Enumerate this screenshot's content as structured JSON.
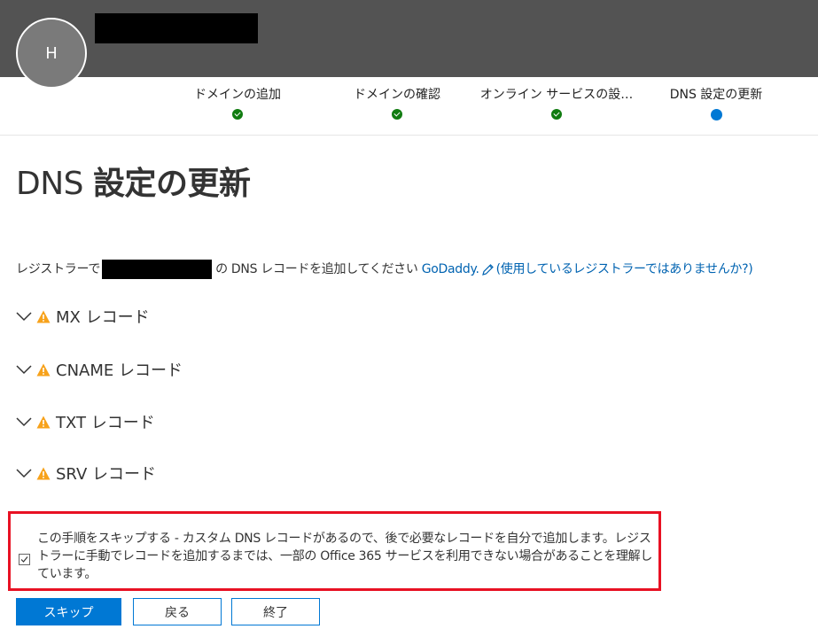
{
  "header": {
    "avatar_initial": "H"
  },
  "steps": [
    {
      "label": "ドメインの追加",
      "status": "done"
    },
    {
      "label": "ドメインの確認",
      "status": "done"
    },
    {
      "label": "オンライン サービスの設…",
      "status": "done"
    },
    {
      "label": "DNS 設定の更新",
      "status": "current"
    }
  ],
  "page": {
    "title_prefix": "DNS",
    "title_bold": "設定の更新",
    "desc_before": "レジストラーで",
    "desc_after": "の DNS レコードを追加してください",
    "registrar_link": "GoDaddy.",
    "not_registrar_link": "(使用しているレジストラーではありませんか?)"
  },
  "records": [
    {
      "label": "MX レコード"
    },
    {
      "label": "CNAME レコード"
    },
    {
      "label": "TXT レコード"
    },
    {
      "label": "SRV レコード"
    }
  ],
  "skip_option": {
    "text": "この手順をスキップする - カスタム DNS レコードがあるので、後で必要なレコードを自分で追加します。レジストラーに手動でレコードを追加するまでは、一部の Office 365 サービスを利用できない場合があることを理解しています。",
    "checked": true
  },
  "buttons": {
    "skip": "スキップ",
    "back": "戻る",
    "finish": "終了"
  },
  "colors": {
    "accent": "#0078d4",
    "success": "#107c10",
    "warning": "#f7a21b",
    "highlight": "#e81123",
    "header_bg": "#535353"
  }
}
